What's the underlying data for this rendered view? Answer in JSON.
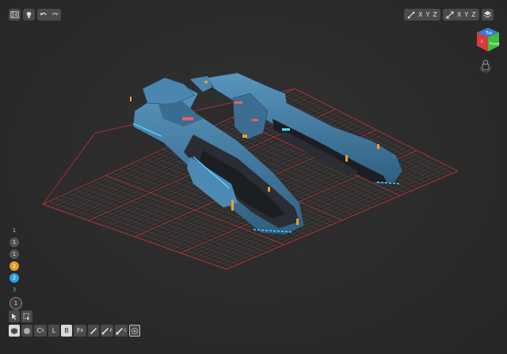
{
  "top_left_toolbar": {
    "icons": [
      "panel-toggle-icon",
      "lightbulb-icon",
      "undo-icon",
      "redo-icon"
    ]
  },
  "top_right_toolbar": {
    "mirror_axes": {
      "x": "X",
      "y": "Y",
      "z": "Z"
    },
    "flip_axes": {
      "x": "X",
      "y": "Y",
      "z": "Z"
    }
  },
  "nav_cube": {
    "top_label": "Top",
    "front_label": "Front",
    "right_label": "R",
    "colors": {
      "top": "#3a78d8",
      "front": "#3cbf3c",
      "right": "#d83a3a"
    }
  },
  "left_numbers": [
    {
      "label": "1",
      "style": "plain"
    },
    {
      "label": "1",
      "style": "gray"
    },
    {
      "label": "1",
      "style": "gray"
    },
    {
      "label": "2",
      "style": "orange"
    },
    {
      "label": "2",
      "style": "blue"
    },
    {
      "label": "3",
      "style": "green"
    },
    {
      "label": "1",
      "style": "big"
    }
  ],
  "bottom_toolbar": {
    "c_label": "C",
    "c_sub": "S",
    "l_label": "L",
    "b_label": "B",
    "f_label": "F",
    "f_sub": "B",
    "p_sub": "P",
    "c2_sub": "C"
  },
  "colors": {
    "grid_line": "#6a5656",
    "grid_border": "#c23a3a",
    "hull_blue": "#3f7fa8",
    "accent_orange": "#f0a020",
    "accent_cyan": "#4fd6ff"
  }
}
